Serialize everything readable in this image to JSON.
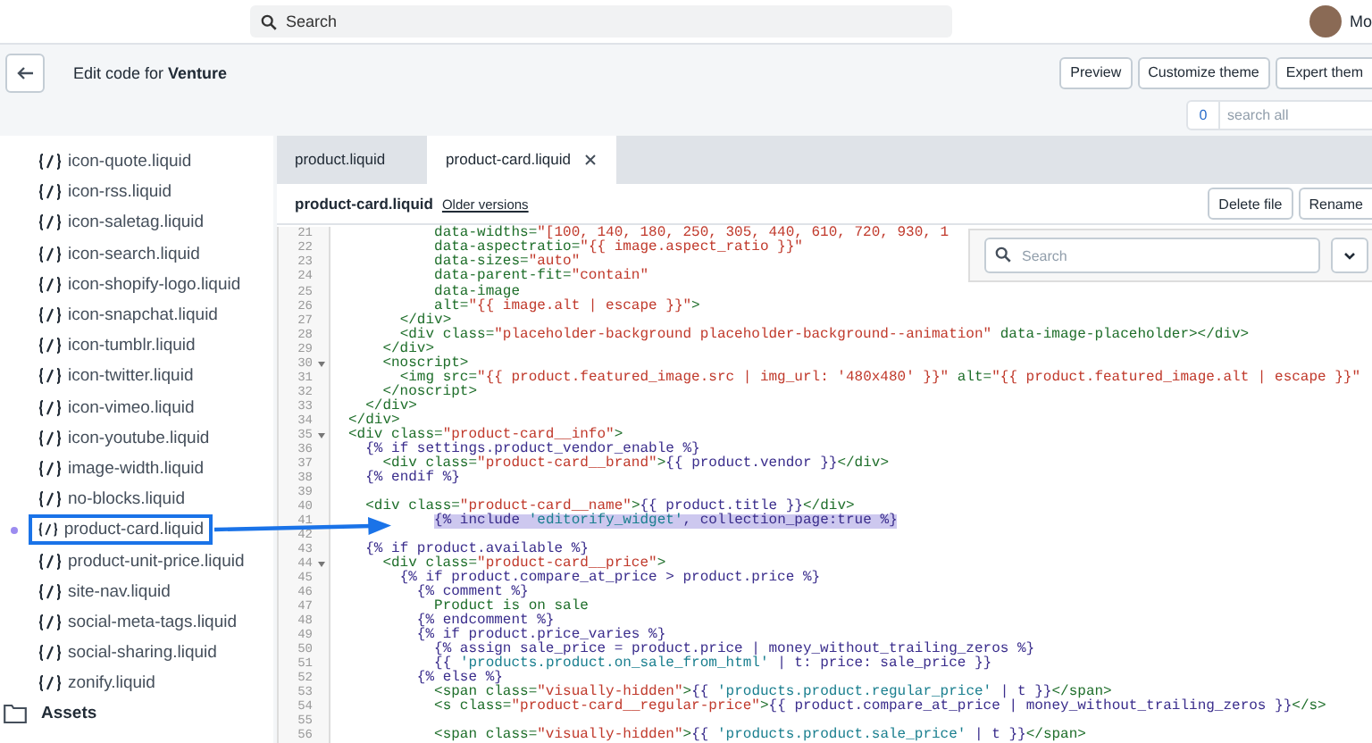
{
  "top_bar": {
    "search": {
      "placeholder": "Search"
    },
    "user": {
      "name": "Mo"
    }
  },
  "header": {
    "title": "Edit code for **Venture**",
    "buttons": [
      "Preview",
      "Customize theme",
      "Expert them"
    ]
  },
  "search_all": {
    "count": "0",
    "placeholder": "search all"
  },
  "sidebar": {
    "items": [
      {
        "label": "icon-quote.liquid",
        "selected": false,
        "modified": false
      },
      {
        "label": "icon-rss.liquid",
        "selected": false,
        "modified": false
      },
      {
        "label": "icon-saletag.liquid",
        "selected": false,
        "modified": false
      },
      {
        "label": "icon-search.liquid",
        "selected": false,
        "modified": false
      },
      {
        "label": "icon-shopify-logo.liquid",
        "selected": false,
        "modified": false
      },
      {
        "label": "icon-snapchat.liquid",
        "selected": false,
        "modified": false
      },
      {
        "label": "icon-tumblr.liquid",
        "selected": false,
        "modified": false
      },
      {
        "label": "icon-twitter.liquid",
        "selected": false,
        "modified": false
      },
      {
        "label": "icon-vimeo.liquid",
        "selected": false,
        "modified": false
      },
      {
        "label": "icon-youtube.liquid",
        "selected": false,
        "modified": false
      },
      {
        "label": "image-width.liquid",
        "selected": false,
        "modified": false
      },
      {
        "label": "no-blocks.liquid",
        "selected": false,
        "modified": false
      },
      {
        "label": "product-card.liquid",
        "selected": true,
        "modified": true
      },
      {
        "label": "product-unit-price.liquid",
        "selected": false,
        "modified": false
      },
      {
        "label": "site-nav.liquid",
        "selected": false,
        "modified": false
      },
      {
        "label": "social-meta-tags.liquid",
        "selected": false,
        "modified": false
      },
      {
        "label": "social-sharing.liquid",
        "selected": false,
        "modified": false
      },
      {
        "label": "zonify.liquid",
        "selected": false,
        "modified": false
      }
    ],
    "folder": {
      "label": "Assets"
    }
  },
  "tabs": [
    {
      "label": "product.liquid",
      "selected": false
    },
    {
      "label": "product-card.liquid",
      "selected": true
    }
  ],
  "file_header": {
    "name": "product-card.liquid",
    "link": "Older versions",
    "buttons": [
      "Delete file",
      "Rename"
    ]
  },
  "find_panel": {
    "placeholder": "Search"
  },
  "code": {
    "lines": [
      {
        "number": "21",
        "text": "          data-widths=\"[100, 140, 180, 250, 305, 440, 610, 720, 930, 1",
        "foldable": false,
        "highlighted": false
      },
      {
        "number": "22",
        "text": "          data-aspectratio=\"{{ image.aspect_ratio }}\"",
        "foldable": false,
        "highlighted": false
      },
      {
        "number": "23",
        "text": "          data-sizes=\"auto\"",
        "foldable": false,
        "highlighted": false
      },
      {
        "number": "24",
        "text": "          data-parent-fit=\"contain\"",
        "foldable": false,
        "highlighted": false
      },
      {
        "number": "25",
        "text": "          data-image",
        "foldable": false,
        "highlighted": false
      },
      {
        "number": "26",
        "text": "          alt=\"{{ image.alt | escape }}\">",
        "foldable": false,
        "highlighted": false
      },
      {
        "number": "27",
        "text": "      </div>",
        "foldable": false,
        "highlighted": false
      },
      {
        "number": "28",
        "text": "      <div class=\"placeholder-background placeholder-background--animation\" data-image-placeholder></div>",
        "foldable": false,
        "highlighted": false
      },
      {
        "number": "29",
        "text": "    </div>",
        "foldable": false,
        "highlighted": false
      },
      {
        "number": "30",
        "text": "    <noscript>",
        "foldable": true,
        "highlighted": false
      },
      {
        "number": "31",
        "text": "      <img src=\"{{ product.featured_image.src | img_url: '480x480' }}\" alt=\"{{ product.featured_image.alt | escape }}\"",
        "foldable": false,
        "highlighted": false
      },
      {
        "number": "32",
        "text": "    </noscript>",
        "foldable": false,
        "highlighted": false
      },
      {
        "number": "33",
        "text": "  </div>",
        "foldable": false,
        "highlighted": false
      },
      {
        "number": "34",
        "text": "</div>",
        "foldable": false,
        "highlighted": false
      },
      {
        "number": "35",
        "text": "<div class=\"product-card__info\">",
        "foldable": true,
        "highlighted": false
      },
      {
        "number": "36",
        "text": "  {% if settings.product_vendor_enable %}",
        "foldable": false,
        "highlighted": false
      },
      {
        "number": "37",
        "text": "    <div class=\"product-card__brand\">{{ product.vendor }}</div>",
        "foldable": false,
        "highlighted": false
      },
      {
        "number": "38",
        "text": "  {% endif %}",
        "foldable": false,
        "highlighted": false
      },
      {
        "number": "39",
        "foldable": false
      },
      {
        "number": "40",
        "text": "  <div class=\"product-card__name\">{{ product.title }}</div>",
        "foldable": false,
        "highlighted": false
      },
      {
        "number": "41",
        "text": "          {% include 'editorify_widget', collection_page:true %}",
        "foldable": false,
        "highlighted": true
      },
      {
        "number": "42",
        "foldable": false
      },
      {
        "number": "43",
        "text": "  {% if product.available %}",
        "foldable": false,
        "highlighted": false
      },
      {
        "number": "44",
        "text": "    <div class=\"product-card__price\">",
        "foldable": true,
        "highlighted": false
      },
      {
        "number": "45",
        "text": "      {% if product.compare_at_price > product.price %}",
        "foldable": false,
        "highlighted": false
      },
      {
        "number": "46",
        "text": "        {% comment %}",
        "foldable": false,
        "highlighted": false
      },
      {
        "number": "47",
        "text": "          Product is on sale",
        "foldable": false,
        "highlighted": false
      },
      {
        "number": "48",
        "text": "        {% endcomment %}",
        "foldable": false,
        "highlighted": false
      },
      {
        "number": "49",
        "text": "        {% if product.price_varies %}",
        "foldable": false,
        "highlighted": false
      },
      {
        "number": "50",
        "text": "          {% assign sale_price = product.price | money_without_trailing_zeros %}",
        "foldable": false,
        "highlighted": false
      },
      {
        "number": "51",
        "text": "          {{ 'products.product.on_sale_from_html' | t: price: sale_price }}",
        "foldable": false,
        "highlighted": false
      },
      {
        "number": "52",
        "text": "        {% else %}",
        "foldable": false,
        "highlighted": false
      },
      {
        "number": "53",
        "text": "          <span class=\"visually-hidden\">{{ 'products.product.regular_price' | t }}</span>",
        "foldable": false,
        "highlighted": false
      },
      {
        "number": "54",
        "text": "          <s class=\"product-card__regular-price\">{{ product.compare_at_price | money_without_trailing_zeros }}</s>",
        "foldable": false,
        "highlighted": false
      },
      {
        "number": "55",
        "foldable": false
      },
      {
        "number": "56",
        "text": "          <span class=\"visually-hidden\">{{ 'products.product.sale_price' | t }}</span>",
        "foldable": false,
        "highlighted": false
      }
    ]
  }
}
